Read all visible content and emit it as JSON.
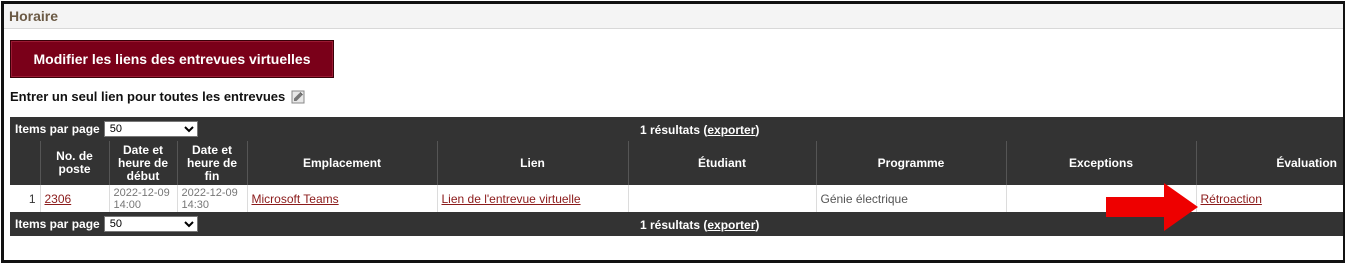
{
  "panel": {
    "title": "Horaire"
  },
  "actions": {
    "modify_links_label": "Modifier les liens des entrevues virtuelles",
    "single_link_label": "Entrer un seul lien pour toutes les entrevues"
  },
  "pager": {
    "items_per_page_label": "Items par page",
    "items_per_page_value": "50",
    "results_prefix": "1 résultats (",
    "export_label": "exporter",
    "results_suffix": ")"
  },
  "columns": {
    "index": "",
    "post_no": "No. de poste",
    "start": "Date et heure de début",
    "end": "Date et heure de fin",
    "location": "Emplacement",
    "link": "Lien",
    "student": "Étudiant",
    "program": "Programme",
    "exceptions": "Exceptions",
    "evaluation": "Évaluation"
  },
  "rows": [
    {
      "index": "1",
      "post_no": "2306",
      "start": "2022-12-09 14:00",
      "end": "2022-12-09 14:30",
      "location": "Microsoft Teams",
      "link": "Lien de l'entrevue virtuelle",
      "student": "",
      "program": "Génie électrique",
      "exceptions": "",
      "evaluation": "Rétroaction"
    }
  ],
  "colors": {
    "primary_button": "#7a0019",
    "header_bar": "#333333",
    "link": "#8b1a1a",
    "annotation_arrow": "#ee0000"
  },
  "icons": {
    "single_link": "edit-link-icon",
    "annotation": "red-arrow-annotation"
  }
}
